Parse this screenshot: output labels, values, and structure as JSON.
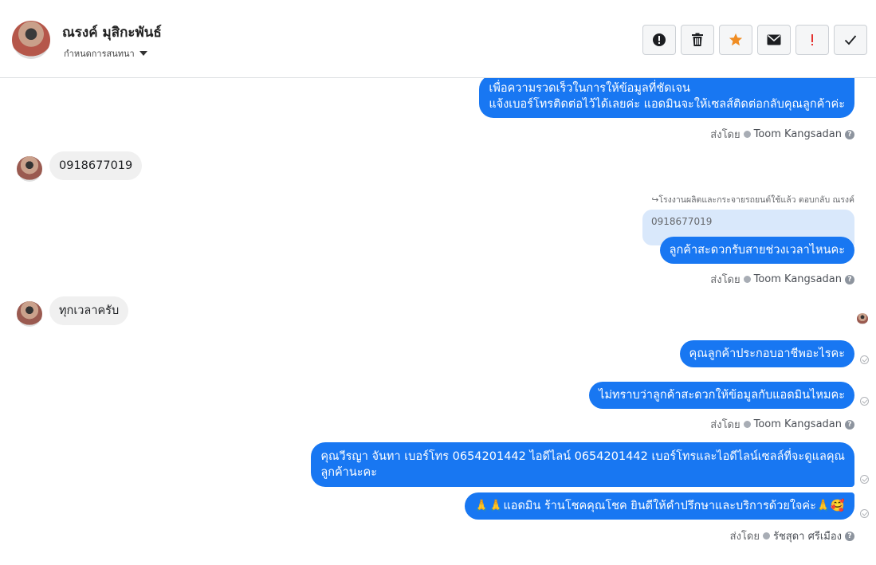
{
  "header": {
    "name": "ณรงค์ มุสิกะพันธ์",
    "subtitle": "กำหนดการสนทนา"
  },
  "toolbar": {
    "icons": [
      "alert-circle-icon",
      "trash-icon",
      "star-icon",
      "envelope-icon",
      "exclamation-icon",
      "check-icon"
    ],
    "colors": {
      "star": "#f08c22",
      "exclamation": "#e4312f",
      "accent": "#1877f2"
    }
  },
  "messages": {
    "m1_line1": "เพื่อความรวดเร็วในการให้ข้อมูลที่ชัดเจน",
    "m1_line2": "แจ้งเบอร์โทรติดต่อไว้ได้เลยค่ะ แอดมินจะให้เซลส์ติดต่อกลับคุณลูกค้าค่ะ",
    "sent_by_label": "ส่งโดย",
    "agent1": "Toom Kangsadan",
    "in1": "0918677019",
    "reply_note": "↪โรงงานผลิตและกระจายรถยนต์ใช้แล้ว ตอบกลับ ณรงค์",
    "quoted": "0918677019",
    "m2": "ลูกค้าสะดวกรับสายช่วงเวลาไหนคะ",
    "in2": "ทุกเวลาครับ",
    "m3": "คุณลูกค้าประกอบอาชีพอะไรคะ",
    "m4": "ไม่ทราบว่าลูกค้าสะดวกให้ข้อมูลกับแอดมินไหมคะ",
    "m5_line1": "คุณวีรญา จันทา       เบอร์โทร 0654201442  ไอดีไลน์ 0654201442  เบอร์โทรและไอดีไลน์เซลล์ที่จะดูแลคุณ",
    "m5_line2": "ลูกค้านะคะ",
    "m6": "🙏🙏แอดมิน ร้านโชคคุณโชค ยินดีให้คำปรึกษาและบริการด้วยใจค่ะ🙏🥰",
    "agent2": "รัชสุดา ศรีเมือง"
  }
}
